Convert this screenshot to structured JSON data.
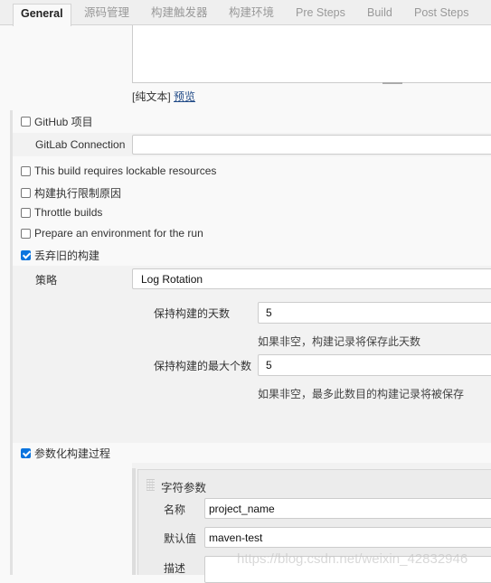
{
  "tabs": [
    {
      "label": "General",
      "active": true
    },
    {
      "label": "源码管理"
    },
    {
      "label": "构建触发器"
    },
    {
      "label": "构建环境"
    },
    {
      "label": "Pre Steps"
    },
    {
      "label": "Build"
    },
    {
      "label": "Post Steps"
    }
  ],
  "description": {
    "plain_text": "[纯文本]",
    "preview": "预览"
  },
  "options": {
    "github": {
      "label": "GitHub 项目",
      "checked": false
    },
    "gitlab_connection": {
      "label": "GitLab Connection",
      "value": ""
    },
    "lockable": {
      "label": "This build requires lockable resources",
      "checked": false
    },
    "throttle_reason": {
      "label": "构建执行限制原因",
      "checked": false
    },
    "throttle": {
      "label": "Throttle builds",
      "checked": false
    },
    "prepare_env": {
      "label": "Prepare an environment for the run",
      "checked": false
    },
    "discard": {
      "label": "丢弃旧的构建",
      "checked": true
    },
    "parameterized": {
      "label": "参数化构建过程",
      "checked": true
    }
  },
  "discard": {
    "strategy_label": "策略",
    "strategy_value": "Log Rotation",
    "days_label": "保持构建的天数",
    "days_value": "5",
    "days_hint": "如果非空，构建记录将保存此天数",
    "max_label": "保持构建的最大个数",
    "max_value": "5",
    "max_hint": "如果非空，最多此数目的构建记录将被保存"
  },
  "string_param": {
    "title": "字符参数",
    "name_label": "名称",
    "name_value": "project_name",
    "default_label": "默认值",
    "default_value": "maven-test",
    "desc_label": "描述",
    "desc_value": ""
  },
  "watermark": "https://blog.csdn.net/weixin_42832946"
}
